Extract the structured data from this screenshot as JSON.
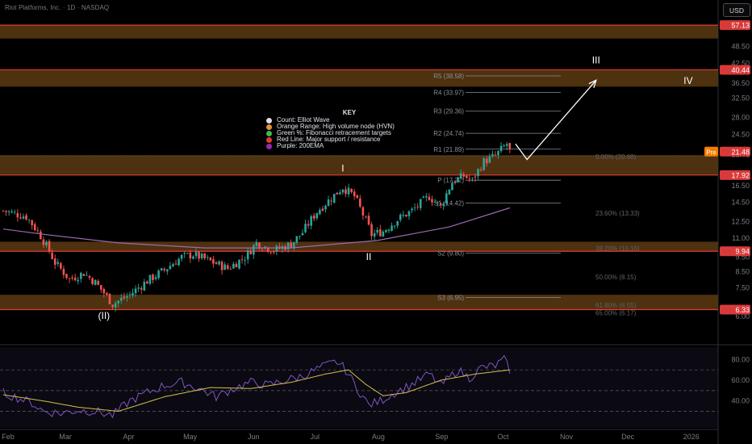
{
  "header": {
    "title": "Riot Platforms, Inc. · 1D · NASDAQ",
    "currency_button": "USD"
  },
  "key": {
    "title": "KEY",
    "items": [
      {
        "label": "Count: Elliot Wave",
        "color": "#e0e0e0"
      },
      {
        "label": "Orange Range: High volume node (HVN)",
        "color": "#e8913a"
      },
      {
        "label": "Green %: Fibonacci retracement targets",
        "color": "#3fb950"
      },
      {
        "label": "Red Line: Major support / resistance",
        "color": "#e53935"
      },
      {
        "label": "Purple: 200EMA",
        "color": "#9c27b0"
      }
    ]
  },
  "chart_data": {
    "type": "candlestick",
    "symbol": "Riot Platforms, Inc.",
    "interval": "1D",
    "exchange": "NASDAQ",
    "x_labels": [
      "Feb",
      "Mar",
      "Apr",
      "May",
      "Jun",
      "Jul",
      "Aug",
      "Sep",
      "Oct",
      "Nov",
      "Dec",
      "2026"
    ],
    "y_ticks": [
      6.0,
      7.5,
      8.5,
      9.5,
      11.0,
      12.5,
      14.5,
      16.5,
      21.01,
      24.5,
      28.0,
      32.5,
      36.5,
      42.5,
      48.5
    ],
    "y_scale": "log",
    "ylim": [
      5.2,
      62
    ],
    "price_badges": [
      {
        "label": "57.13",
        "value": 57.13,
        "color": "#d83a3a"
      },
      {
        "label": "40.44",
        "value": 40.44,
        "color": "#d83a3a"
      },
      {
        "label": "21.48",
        "value": 21.48,
        "color": "#d83a3a"
      },
      {
        "label": "17.92",
        "value": 17.92,
        "color": "#d83a3a"
      },
      {
        "label": "9.94",
        "value": 9.94,
        "color": "#d83a3a"
      },
      {
        "label": "6.33",
        "value": 6.33,
        "color": "#d83a3a"
      }
    ],
    "pre_label": "Pre",
    "resistance_lines": [
      57.13,
      40.44,
      17.92,
      9.94,
      6.33
    ],
    "hvn_zones": [
      [
        51.5,
        57.13
      ],
      [
        35.5,
        40.44
      ],
      [
        17.92,
        20.9
      ],
      [
        9.94,
        10.7
      ],
      [
        6.33,
        7.1
      ]
    ],
    "pivots": [
      {
        "label": "R5 (38.58)",
        "value": 38.58
      },
      {
        "label": "R4 (33.97)",
        "value": 33.97
      },
      {
        "label": "R3 (29.36)",
        "value": 29.36
      },
      {
        "label": "R2 (24.74)",
        "value": 24.74
      },
      {
        "label": "R1 (21.89)",
        "value": 21.89
      },
      {
        "label": "P (17.22)",
        "value": 17.22
      },
      {
        "label": "S1 (14.42)",
        "value": 14.42
      },
      {
        "label": "S2 (9.80)",
        "value": 9.8
      },
      {
        "label": "S3 (6.95)",
        "value": 6.95
      }
    ],
    "fib_levels": [
      {
        "label": "0.00% (20.68)",
        "value": 20.68
      },
      {
        "label": "23.60% (13.33)",
        "value": 13.33
      },
      {
        "label": "38.20% (10.16)",
        "value": 10.16
      },
      {
        "label": "50.00% (8.15)",
        "value": 8.15
      },
      {
        "label": "61.80% (6.55)",
        "value": 6.55
      },
      {
        "label": "65.00% (6.17)",
        "value": 6.17
      }
    ],
    "wave_labels": [
      {
        "label": "(II)",
        "date_index": 35,
        "value": 5.9
      },
      {
        "label": "I",
        "date_index": 118,
        "value": 18.4
      },
      {
        "label": "II",
        "date_index": 127,
        "value": 9.3
      },
      {
        "label": "III",
        "date_index": 206,
        "value": 42.5
      },
      {
        "label": "IV",
        "date_index": 238,
        "value": 36.2
      }
    ],
    "projection_path": [
      [
        178,
        22.8
      ],
      [
        182,
        20.2
      ],
      [
        206,
        37.3
      ]
    ],
    "waypoints": [
      {
        "i": 0,
        "v": 13.6
      },
      {
        "i": 8,
        "v": 13.0
      },
      {
        "i": 13,
        "v": 11.2
      },
      {
        "i": 18,
        "v": 9.1
      },
      {
        "i": 23,
        "v": 8.0
      },
      {
        "i": 28,
        "v": 8.4
      },
      {
        "i": 32,
        "v": 7.8
      },
      {
        "i": 38,
        "v": 6.6
      },
      {
        "i": 44,
        "v": 7.1
      },
      {
        "i": 50,
        "v": 7.9
      },
      {
        "i": 56,
        "v": 8.6
      },
      {
        "i": 62,
        "v": 9.5
      },
      {
        "i": 66,
        "v": 9.7
      },
      {
        "i": 72,
        "v": 9.2
      },
      {
        "i": 78,
        "v": 8.7
      },
      {
        "i": 84,
        "v": 9.5
      },
      {
        "i": 88,
        "v": 10.6
      },
      {
        "i": 94,
        "v": 10.0
      },
      {
        "i": 100,
        "v": 10.5
      },
      {
        "i": 104,
        "v": 11.5
      },
      {
        "i": 109,
        "v": 13.5
      },
      {
        "i": 114,
        "v": 15.0
      },
      {
        "i": 118,
        "v": 16.3
      },
      {
        "i": 122,
        "v": 15.2
      },
      {
        "i": 125,
        "v": 13.2
      },
      {
        "i": 128,
        "v": 11.3
      },
      {
        "i": 132,
        "v": 11.6
      },
      {
        "i": 137,
        "v": 12.7
      },
      {
        "i": 142,
        "v": 13.6
      },
      {
        "i": 148,
        "v": 15.2
      },
      {
        "i": 152,
        "v": 14.0
      },
      {
        "i": 156,
        "v": 17.0
      },
      {
        "i": 160,
        "v": 17.8
      },
      {
        "i": 163,
        "v": 17.2
      },
      {
        "i": 167,
        "v": 19.9
      },
      {
        "i": 171,
        "v": 20.8
      },
      {
        "i": 175,
        "v": 22.8
      },
      {
        "i": 176,
        "v": 21.5
      }
    ],
    "ema200": [
      [
        0,
        11.8
      ],
      [
        15,
        11.3
      ],
      [
        40,
        10.6
      ],
      [
        70,
        10.2
      ],
      [
        100,
        10.2
      ],
      [
        130,
        10.8
      ],
      [
        155,
        12.0
      ],
      [
        176,
        13.9
      ]
    ],
    "rsi": {
      "y_ticks": [
        40.0,
        60.0,
        80.0
      ],
      "levels": [
        70,
        50,
        30
      ],
      "values": [
        {
          "i": 0,
          "v": 48
        },
        {
          "i": 6,
          "v": 42
        },
        {
          "i": 10,
          "v": 38
        },
        {
          "i": 14,
          "v": 30
        },
        {
          "i": 20,
          "v": 28
        },
        {
          "i": 26,
          "v": 31
        },
        {
          "i": 32,
          "v": 30
        },
        {
          "i": 38,
          "v": 26
        },
        {
          "i": 44,
          "v": 40
        },
        {
          "i": 50,
          "v": 48
        },
        {
          "i": 56,
          "v": 55
        },
        {
          "i": 62,
          "v": 58
        },
        {
          "i": 68,
          "v": 52
        },
        {
          "i": 74,
          "v": 44
        },
        {
          "i": 80,
          "v": 52
        },
        {
          "i": 86,
          "v": 58
        },
        {
          "i": 92,
          "v": 55
        },
        {
          "i": 98,
          "v": 60
        },
        {
          "i": 104,
          "v": 64
        },
        {
          "i": 110,
          "v": 72
        },
        {
          "i": 116,
          "v": 78
        },
        {
          "i": 119,
          "v": 70
        },
        {
          "i": 123,
          "v": 52
        },
        {
          "i": 127,
          "v": 36
        },
        {
          "i": 131,
          "v": 40
        },
        {
          "i": 136,
          "v": 48
        },
        {
          "i": 142,
          "v": 56
        },
        {
          "i": 148,
          "v": 66
        },
        {
          "i": 152,
          "v": 55
        },
        {
          "i": 158,
          "v": 70
        },
        {
          "i": 162,
          "v": 62
        },
        {
          "i": 166,
          "v": 72
        },
        {
          "i": 171,
          "v": 74
        },
        {
          "i": 174,
          "v": 80
        },
        {
          "i": 176,
          "v": 70
        }
      ],
      "ma": [
        {
          "i": 0,
          "v": 46
        },
        {
          "i": 14,
          "v": 40
        },
        {
          "i": 26,
          "v": 34
        },
        {
          "i": 40,
          "v": 30
        },
        {
          "i": 56,
          "v": 44
        },
        {
          "i": 72,
          "v": 53
        },
        {
          "i": 86,
          "v": 52
        },
        {
          "i": 100,
          "v": 58
        },
        {
          "i": 112,
          "v": 66
        },
        {
          "i": 120,
          "v": 70
        },
        {
          "i": 126,
          "v": 56
        },
        {
          "i": 132,
          "v": 45
        },
        {
          "i": 140,
          "v": 48
        },
        {
          "i": 152,
          "v": 60
        },
        {
          "i": 164,
          "v": 66
        },
        {
          "i": 176,
          "v": 70
        }
      ]
    }
  },
  "colors": {
    "background": "#000000",
    "up": "#26a69a",
    "down": "#ef5350",
    "hvn": "#5c3a12",
    "red_line": "#e53935",
    "ema": "#9c6ab0",
    "rsi_line": "#7e57c2",
    "rsi_ma": "#d4c04a"
  }
}
